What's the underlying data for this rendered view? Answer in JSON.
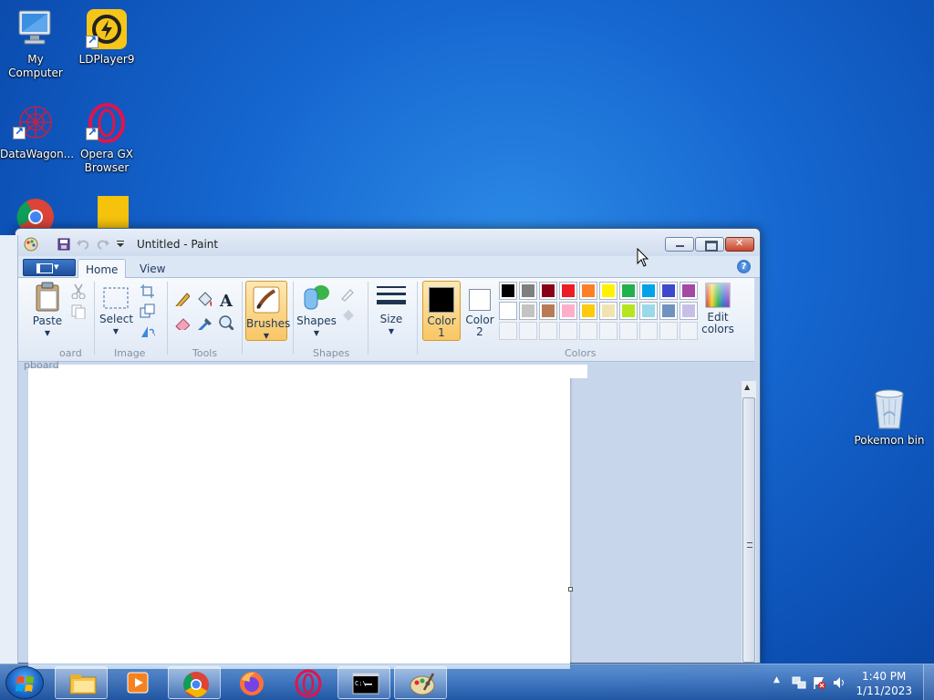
{
  "desktop": {
    "icons": [
      {
        "label": "My Computer"
      },
      {
        "label": "LDPlayer9"
      },
      {
        "label": "DataWagon..."
      },
      {
        "label": "Opera GX",
        "label2": "Browser"
      },
      {
        "label": "Pokemon bin"
      }
    ]
  },
  "window": {
    "title": "Untitled - Paint",
    "tabs": [
      "Home",
      "View"
    ],
    "active_tab": "Home",
    "help": "?"
  },
  "ribbon": {
    "clipboard": {
      "paste": "Paste",
      "group": "oard"
    },
    "image": {
      "select": "Select",
      "group": "Image"
    },
    "tools": {
      "group": "Tools"
    },
    "brushes": {
      "label": "Brushes"
    },
    "shapes": {
      "label": "Shapes",
      "group": "Shapes"
    },
    "size": {
      "label": "Size"
    },
    "color1": {
      "line1": "Color",
      "line2": "1",
      "value": "#000000"
    },
    "color2": {
      "line1": "Color",
      "line2": "2",
      "value": "#ffffff"
    },
    "colors_group": "Colors",
    "edit_colors": {
      "line1": "Edit",
      "line2": "colors"
    },
    "palette": [
      "#000000",
      "#7f7f7f",
      "#880015",
      "#ed1c24",
      "#ff7f27",
      "#fff200",
      "#22b14c",
      "#00a2e8",
      "#3f48cc",
      "#a349a4",
      "#ffffff",
      "#c3c3c3",
      "#b97a57",
      "#ffaec9",
      "#ffc90e",
      "#efe4b0",
      "#b5e61d",
      "#99d9ea",
      "#7092be",
      "#c8bfe7"
    ],
    "palette_empty_slots": 10
  },
  "left_edge_text": "pboard",
  "taskbar": {
    "clock_time": "1:40 PM",
    "clock_date": "1/11/2023"
  }
}
